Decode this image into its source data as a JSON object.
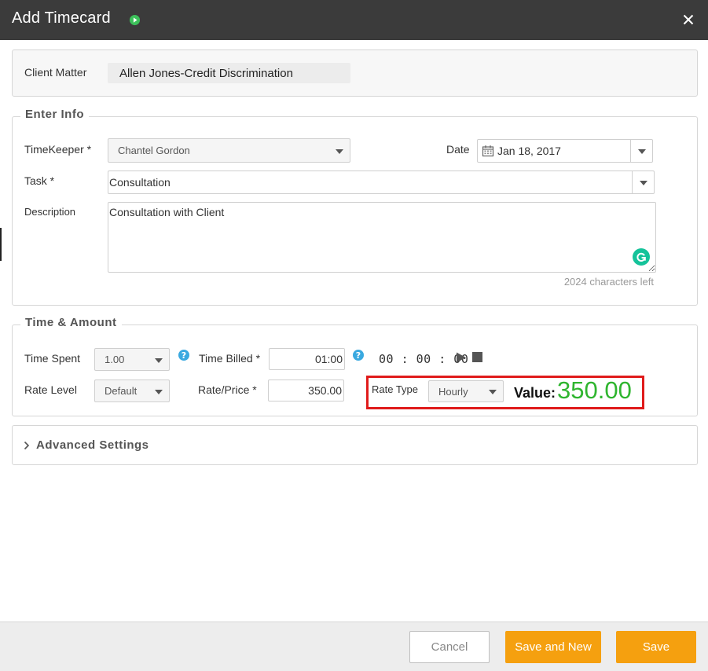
{
  "dialog": {
    "title": "Add Timecard",
    "close_symbol": "✕"
  },
  "client_matter": {
    "label": "Client Matter",
    "value": "Allen Jones-Credit Discrimination"
  },
  "enter_info": {
    "legend": "Enter Info",
    "timekeeper_label": "TimeKeeper *",
    "timekeeper_value": "Chantel Gordon",
    "date_label": "Date",
    "date_value": "Jan 18, 2017",
    "task_label": "Task *",
    "task_value": "Consultation",
    "description_label": "Description",
    "description_value": "Consultation with Client",
    "chars_left": "2024 characters left"
  },
  "time_amount": {
    "legend": "Time & Amount",
    "time_spent_label": "Time Spent",
    "time_spent_value": "1.00",
    "time_billed_label": "Time Billed *",
    "time_billed_value": "01:00",
    "timer_display": "00 : 00 : 00",
    "rate_level_label": "Rate Level",
    "rate_level_value": "Default",
    "rate_price_label": "Rate/Price *",
    "rate_price_value": "350.00",
    "rate_type_label": "Rate Type",
    "rate_type_value": "Hourly",
    "value_label": "Value:",
    "value_amount": "350.00",
    "help_symbol": "?"
  },
  "advanced": {
    "label": "Advanced Settings"
  },
  "footer": {
    "cancel_label": "Cancel",
    "save_new_label": "Save and New",
    "save_label": "Save"
  },
  "colors": {
    "titlebar": "#3b3b3b",
    "accent_orange": "#f5a00f",
    "value_green": "#2fb52f",
    "highlight_red": "#e01b1b",
    "help_blue": "#3aa9e0"
  },
  "icons": {
    "title": "play-circle-icon",
    "close": "close-icon",
    "date": "calendar-icon",
    "grammarly": "grammarly-icon",
    "help": "help-circle-icon",
    "timer_play": "play-icon",
    "timer_stop": "stop-icon",
    "advanced": "chevron-right-icon"
  }
}
